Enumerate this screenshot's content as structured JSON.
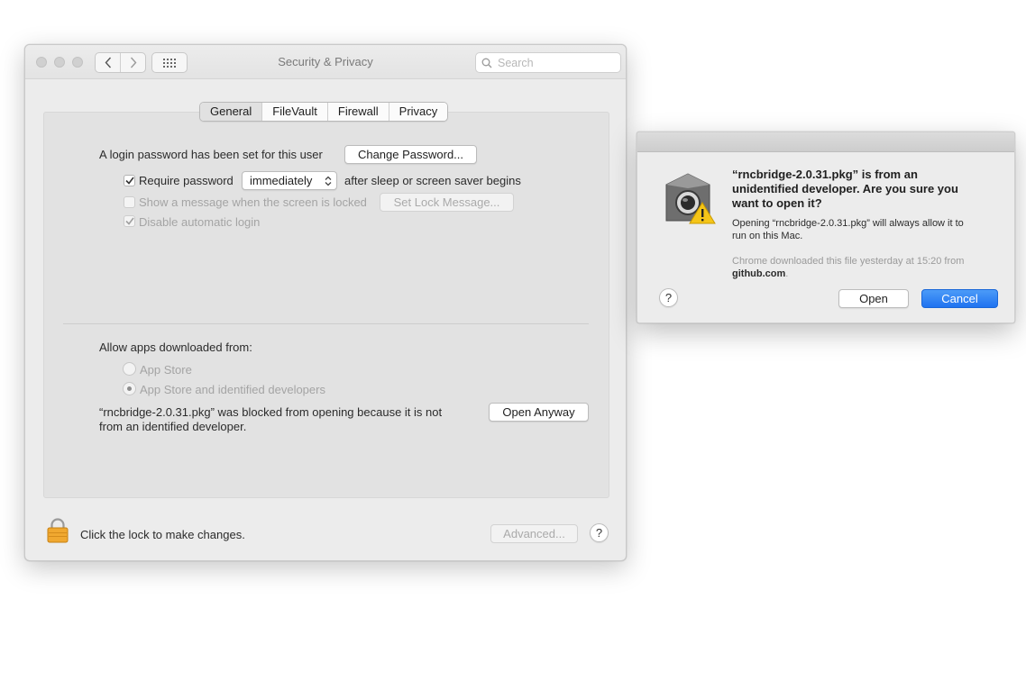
{
  "window": {
    "title": "Security & Privacy",
    "search_placeholder": "Search",
    "tabs": [
      {
        "label": "General",
        "selected": true
      },
      {
        "label": "FileVault",
        "selected": false
      },
      {
        "label": "Firewall",
        "selected": false
      },
      {
        "label": "Privacy",
        "selected": false
      }
    ],
    "general": {
      "login_text": "A login password has been set for this user",
      "change_password_label": "Change Password...",
      "require_password": {
        "label": "Require password",
        "checked": true,
        "value": "immediately",
        "suffix": "after sleep or screen saver begins"
      },
      "show_message": {
        "label": "Show a message when the screen is locked",
        "checked": false,
        "enabled": false
      },
      "set_lock_message_label": "Set Lock Message...",
      "disable_auto_login": {
        "label": "Disable automatic login",
        "checked": true,
        "enabled": false
      },
      "allow_apps_label": "Allow apps downloaded from:",
      "radio_options": [
        {
          "label": "App Store",
          "selected": false
        },
        {
          "label": "App Store and identified developers",
          "selected": true
        }
      ],
      "blocked_line1": "“rncbridge-2.0.31.pkg” was blocked from opening because it is not",
      "blocked_line2": "from an identified developer.",
      "open_anyway_label": "Open Anyway"
    },
    "footer": {
      "lock_text": "Click the lock to make changes.",
      "advanced_label": "Advanced...",
      "help_label": "?"
    }
  },
  "dialog": {
    "title_line1": "“rncbridge-2.0.31.pkg” is from an",
    "title_line2": "unidentified developer. Are you sure you",
    "title_line3": "want to open it?",
    "info_line1": "Opening “rncbridge-2.0.31.pkg” will always allow it to",
    "info_line2": "run on this Mac.",
    "source_line": "Chrome downloaded this file yesterday at 15:20 from",
    "source_domain": "github.com",
    "source_period": ".",
    "help_label": "?",
    "open_label": "Open",
    "cancel_label": "Cancel"
  },
  "colors": {
    "accent": "#1f73f0",
    "lock": "#f0a830"
  },
  "icons": [
    "chevron-left-icon",
    "chevron-right-icon",
    "grid-icon",
    "search-icon",
    "checkmark-icon",
    "lock-icon",
    "gatekeeper-warning-icon"
  ]
}
